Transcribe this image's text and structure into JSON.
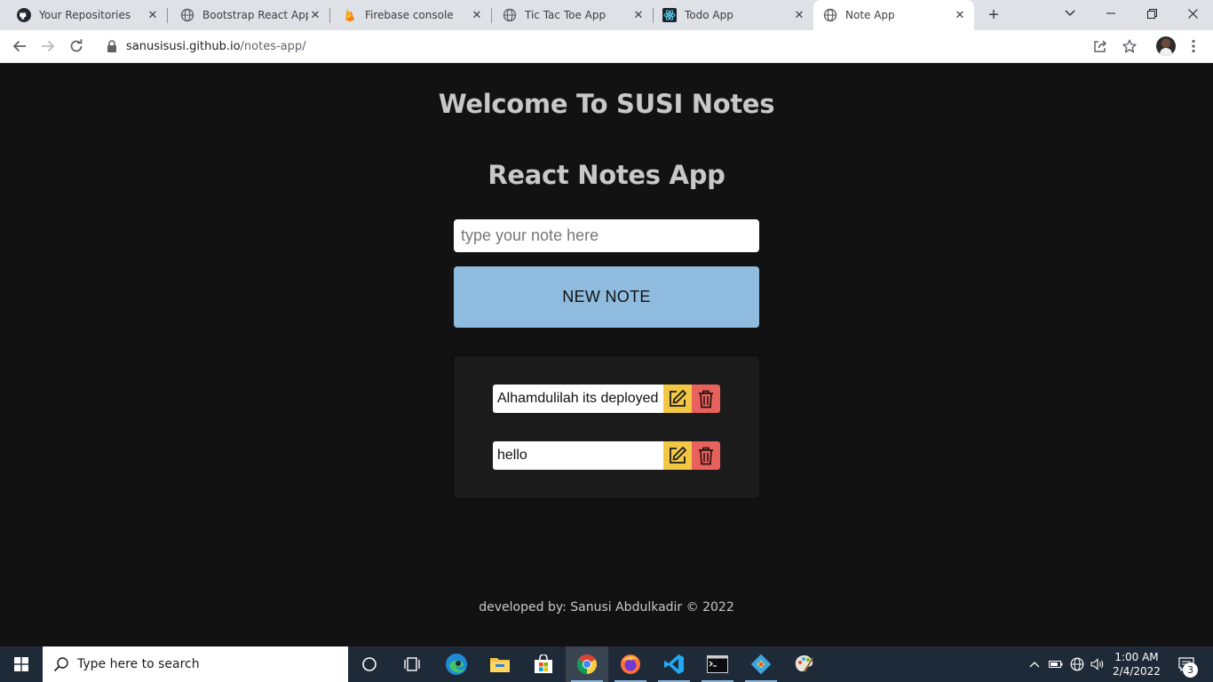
{
  "browser": {
    "tabs": [
      {
        "title": "Your Repositories",
        "favicon": "github-icon"
      },
      {
        "title": "Bootstrap React App",
        "favicon": "globe-icon"
      },
      {
        "title": "Firebase console",
        "favicon": "firebase-icon"
      },
      {
        "title": "Tic Tac Toe App",
        "favicon": "globe-icon"
      },
      {
        "title": "Todo App",
        "favicon": "react-icon"
      },
      {
        "title": "Note App",
        "favicon": "globe-icon",
        "active": true
      }
    ],
    "tab_close_glyph": "✕",
    "new_tab_glyph": "+",
    "url_host": "sanusisusi.github.io",
    "url_path": "/notes-app/"
  },
  "app": {
    "welcome_title": "Welcome To SUSI Notes",
    "subtitle": "React Notes App",
    "input_placeholder": "type your note here",
    "input_value": "",
    "new_note_label": "NEW NOTE",
    "notes": [
      {
        "text": "Alhamdulilah its deployed"
      },
      {
        "text": "hello"
      }
    ],
    "footer": "developed by: Sanusi Abdulkadir © 2022",
    "colors": {
      "background": "#121212",
      "heading": "#c8c8c8",
      "new_note_button": "#8fbcde",
      "edit_button": "#f2c744",
      "delete_button": "#e8615c"
    }
  },
  "taskbar": {
    "search_placeholder": "Type here to search",
    "time": "1:00 AM",
    "date": "2/4/2022",
    "notification_count": "3",
    "apps": [
      "cortana-icon",
      "task-view-icon",
      "edge-icon",
      "file-explorer-icon",
      "store-icon",
      "chrome-icon",
      "firefox-icon",
      "vscode-icon",
      "terminal-icon",
      "git-icon",
      "paint-icon"
    ]
  }
}
